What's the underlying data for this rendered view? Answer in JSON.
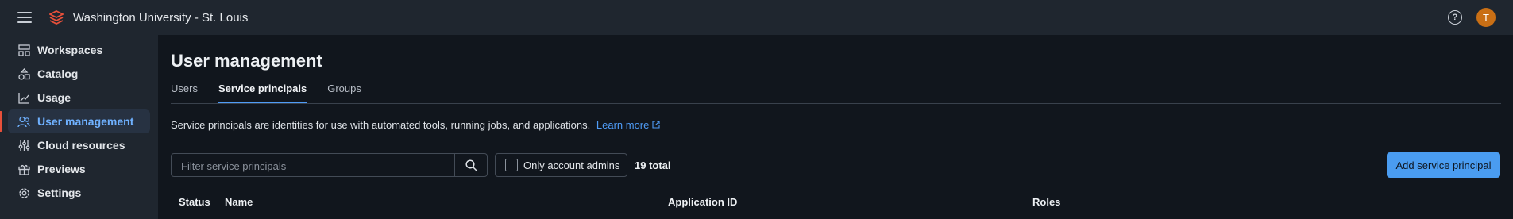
{
  "header": {
    "org_name": "Washington University - St. Louis",
    "avatar_initial": "T",
    "help_glyph": "?",
    "brand_color": "#e8503a",
    "avatar_color": "#c96f15"
  },
  "sidebar": {
    "items": [
      {
        "label": "Workspaces",
        "icon": "workspaces-icon"
      },
      {
        "label": "Catalog",
        "icon": "catalog-icon"
      },
      {
        "label": "Usage",
        "icon": "usage-chart-icon"
      },
      {
        "label": "User management",
        "icon": "users-icon",
        "active": true
      },
      {
        "label": "Cloud resources",
        "icon": "sliders-icon"
      },
      {
        "label": "Previews",
        "icon": "gift-icon"
      },
      {
        "label": "Settings",
        "icon": "gear-icon"
      }
    ]
  },
  "page": {
    "title": "User management",
    "tabs": [
      {
        "label": "Users"
      },
      {
        "label": "Service principals",
        "active": true
      },
      {
        "label": "Groups"
      }
    ],
    "description": "Service principals are identities for use with automated tools, running jobs, and applications.",
    "learn_more": "Learn more",
    "search_placeholder": "Filter service principals",
    "only_admins_label": "Only account admins",
    "only_admins_checked": false,
    "total": "19 total",
    "add_button": "Add service principal",
    "accent_color": "#4a9cf0"
  },
  "table": {
    "columns": [
      "Status",
      "Name",
      "Application ID",
      "Roles"
    ]
  }
}
